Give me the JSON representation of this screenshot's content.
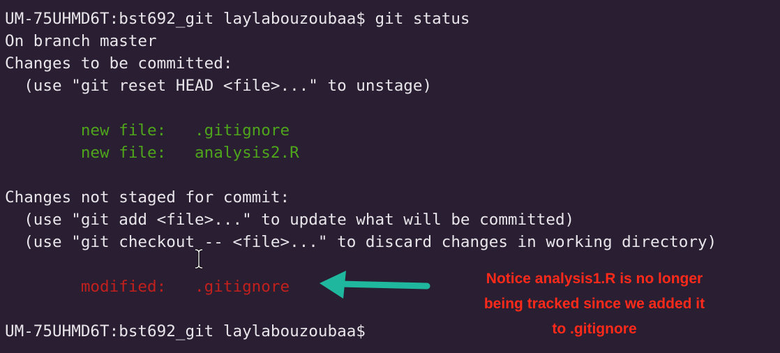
{
  "terminal": {
    "lines": [
      {
        "text": "UM-75UHMD6T:bst692_git laylabouzoubaa$ git status",
        "kind": "prompt"
      },
      {
        "text": "On branch master",
        "kind": "output"
      },
      {
        "text": "Changes to be committed:",
        "kind": "output"
      },
      {
        "text": "  (use \"git reset HEAD <file>...\" to unstage)",
        "kind": "output"
      },
      {
        "text": "",
        "kind": "blank"
      },
      {
        "text": "        new file:   .gitignore",
        "kind": "staged"
      },
      {
        "text": "        new file:   analysis2.R",
        "kind": "staged"
      },
      {
        "text": "",
        "kind": "blank"
      },
      {
        "text": "Changes not staged for commit:",
        "kind": "output"
      },
      {
        "text": "  (use \"git add <file>...\" to update what will be committed)",
        "kind": "output"
      },
      {
        "text": "  (use \"git checkout -- <file>...\" to discard changes in working directory)",
        "kind": "output"
      },
      {
        "text": "",
        "kind": "blank"
      },
      {
        "text": "        modified:   .gitignore",
        "kind": "modified"
      },
      {
        "text": "",
        "kind": "blank"
      },
      {
        "text": "UM-75UHMD6T:bst692_git laylabouzoubaa$",
        "kind": "prompt"
      }
    ]
  },
  "annotation": {
    "lines": [
      "Notice analysis1.R is no longer",
      "being tracked since we added it",
      "to .gitignore"
    ]
  },
  "colors": {
    "background": "#2a1e32",
    "text": "#e8e6ea",
    "staged": "#4ea51b",
    "modified": "#c1201c",
    "annotation": "#ff2a1a",
    "arrow": "#1fb89e"
  },
  "icons": {
    "cursor": "text-cursor-icon",
    "arrow": "arrow-left-icon"
  }
}
